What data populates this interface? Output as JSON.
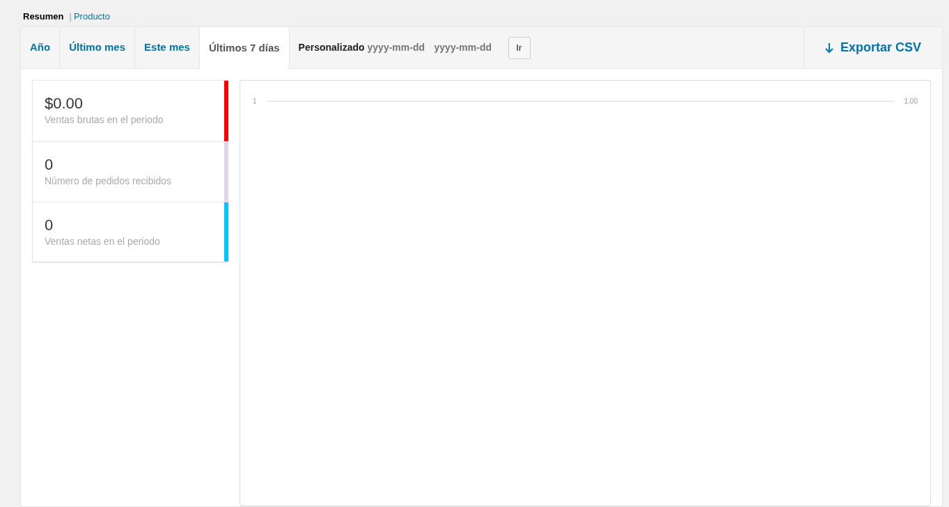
{
  "subnav_separator": "|",
  "subnav": [
    {
      "label": "Resumen",
      "selected": true
    },
    {
      "label": "Producto",
      "selected": false
    }
  ],
  "tabs": [
    {
      "label": "Año",
      "selected": false
    },
    {
      "label": "Último mes",
      "selected": false
    },
    {
      "label": "Este mes",
      "selected": false
    },
    {
      "label": "Últimos 7 días",
      "selected": true
    }
  ],
  "custom_range": {
    "label": "Personalizado",
    "start_placeholder": "yyyy-mm-dd",
    "end_placeholder": "yyyy-mm-dd",
    "button": "Ir"
  },
  "export": {
    "label": "Exportar CSV"
  },
  "legend": [
    {
      "value": "$0.00",
      "label": "Ventas brutas en el periodo",
      "color": "#ff0000"
    },
    {
      "value": "0",
      "label": "Número de pedidos recibidos",
      "color": "#e1d6ee"
    },
    {
      "value": "0",
      "label": "Ventas netas en el periodo",
      "color": "#00c8ff"
    }
  ],
  "chart": {
    "left_axis_label": "1",
    "right_axis_label": "1.00"
  }
}
